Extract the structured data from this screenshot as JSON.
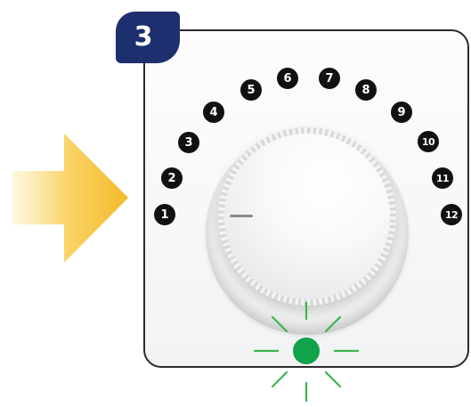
{
  "step": {
    "number": "3"
  },
  "dial": {
    "numbers": [
      "1",
      "2",
      "3",
      "4",
      "5",
      "6",
      "7",
      "8",
      "9",
      "10",
      "11",
      "12"
    ]
  },
  "colors": {
    "badge": "#1d2f6f",
    "arrow": "#f7c23a",
    "led": "#10a34a",
    "number_dot": "#111111"
  },
  "icons": {
    "arrow": "right-arrow-icon",
    "led": "green-led-icon"
  },
  "led": {
    "state": "on",
    "color": "green"
  }
}
